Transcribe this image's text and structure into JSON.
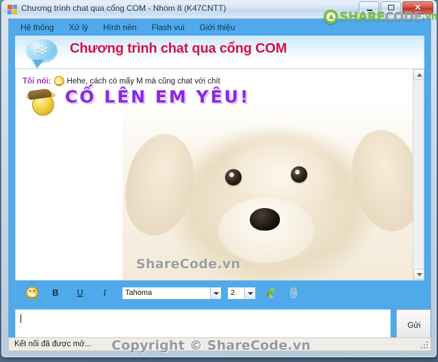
{
  "window": {
    "title": "Chương trình chat qua cổng COM - Nhóm 8 (K47CNTT)",
    "icon": "app-icon",
    "controls": {
      "minimize": "minimize-icon",
      "maximize": "maximize-icon",
      "close": "✕"
    }
  },
  "watermark": {
    "logo_share": "SHARE",
    "logo_code": "CODE",
    "logo_vn": ".vn",
    "chat_overlay": "ShareCode.vn",
    "copyright": "Copyright © ShareCode.vn"
  },
  "menu": {
    "items": [
      {
        "label": "Hệ thống"
      },
      {
        "label": "Xử lý"
      },
      {
        "label": "Hình nền"
      },
      {
        "label": "Flash vui"
      },
      {
        "label": "Giới thiệu"
      }
    ]
  },
  "banner": {
    "title": "Chương trình chat qua cổng COM",
    "bubble_icon": "speech-bubble-snowflake-icon",
    "snowflake": "❄"
  },
  "chat": {
    "messages": [
      {
        "sender": "Tôi nói:",
        "emoticon": "grin-emoticon",
        "text": "Hehe, cách có mấy M mà cũng chat với chít"
      }
    ],
    "sticker": {
      "icon": "cow-emoticon",
      "text": "CỐ LÊN EM YÊU!"
    },
    "scrollbar": {
      "up": "scroll-up-arrow",
      "down": "scroll-down-arrow"
    }
  },
  "toolbar": {
    "emoticon_label": "smiley-icon",
    "bold_label": "B",
    "underline_label": "U",
    "italic_label": "I",
    "font_value": "Tahoma",
    "size_value": "2",
    "pen_label": "pen-icon",
    "clip_label": "paperclip-icon"
  },
  "composer": {
    "value": "",
    "send_label": "Gửi"
  },
  "status": {
    "text": "Kết nối đã được mở..."
  },
  "colors": {
    "app_blue": "#4fa9ea",
    "banner_red": "#d4104a",
    "sender_purple": "#a02cc4",
    "sticker_purple": "#8a2be2",
    "logo_green": "#7ac143"
  }
}
